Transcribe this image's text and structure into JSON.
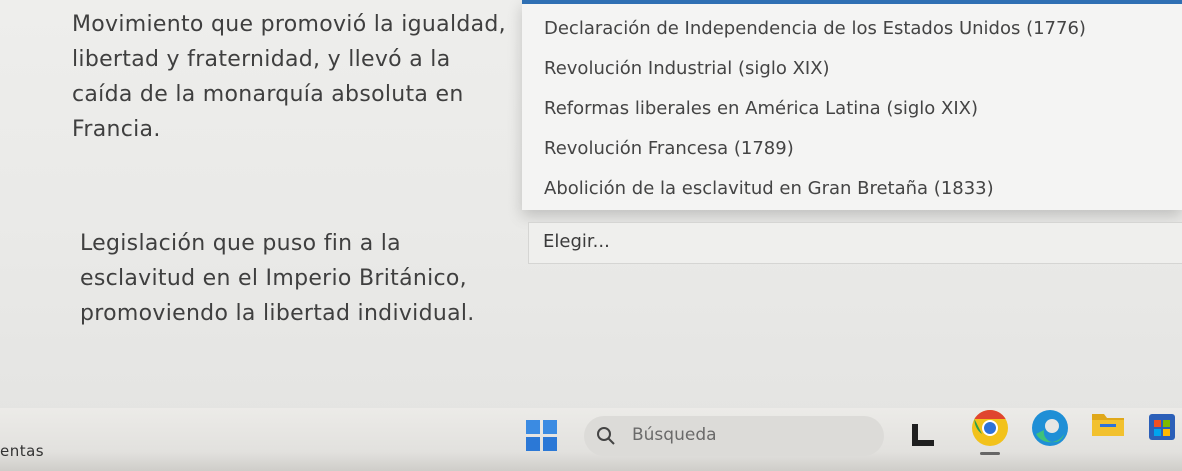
{
  "questions": [
    {
      "text": "Movimiento que promovió la igualdad, libertad y fraternidad, y llevó a la caída de la monarquía absoluta en Francia."
    },
    {
      "text": "Legislación que puso fin a la esclavitud en el Imperio Británico, promoviendo la libertad individual."
    }
  ],
  "dropdown": {
    "options": [
      "Declaración de Independencia de los Estados Unidos (1776)",
      "Revolución Industrial (siglo XIX)",
      "Reformas liberales en América Latina (siglo XIX)",
      "Revolución Francesa (1789)",
      "Abolición de la esclavitud en Gran Bretaña (1833)"
    ]
  },
  "select2": {
    "value": "Elegir..."
  },
  "taskbar": {
    "label": "entas",
    "search_placeholder": "Búsqueda",
    "icons": [
      "windows-start-icon",
      "search-icon",
      "file-explorer-icon",
      "chrome-icon",
      "edge-icon",
      "folder-icon",
      "store-icon"
    ]
  },
  "colors": {
    "accent": "#2f6fb3",
    "background": "#ebebe9"
  }
}
